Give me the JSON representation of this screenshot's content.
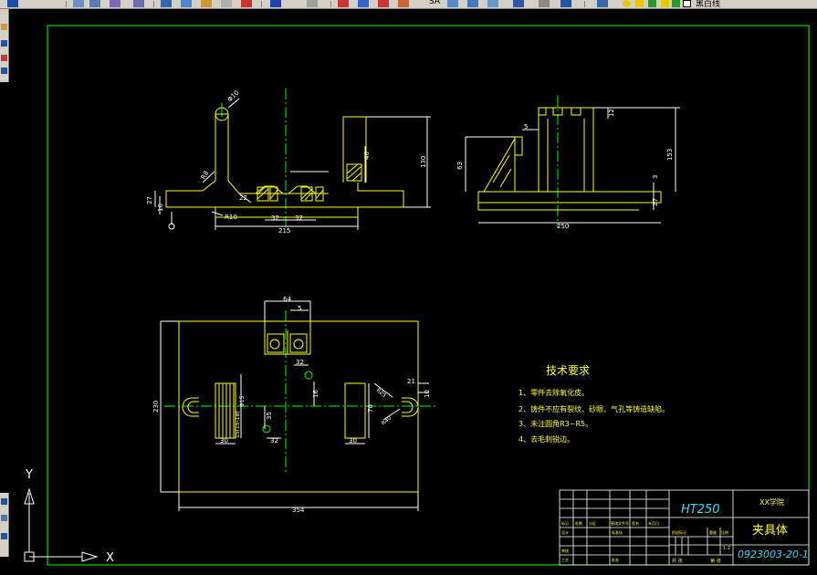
{
  "toolbar": {
    "layer_label": "黑白线",
    "colors": {
      "face": "#d4d0c8",
      "blue": "#1c4fa8",
      "red": "#cc2222",
      "yellow": "#e8c800",
      "green": "#2a9a2a",
      "cyan": "#00a0c0"
    }
  },
  "drawing": {
    "colors": {
      "outline": "#ffff00",
      "frame": "#00ff00",
      "dimension": "#ffffff",
      "centerline": "#00ff00",
      "hatch": "#ffff00",
      "titleblock_cyan": "#33ddff"
    },
    "front_view_dims": {
      "phi10": "Φ10",
      "r8": "R8",
      "r10": "R10",
      "d27": "27",
      "d10": "10",
      "d215": "215",
      "d32a": "32",
      "d32b": "32",
      "d130": "130",
      "d40": "40",
      "d22": "22"
    },
    "side_view_dims": {
      "d5": "5",
      "d12": "12",
      "d153": "153",
      "d63": "63",
      "d3": "3",
      "d27": "27",
      "d250": "250"
    },
    "plan_view_dims": {
      "d64": "64",
      "d5": "5",
      "d230": "230",
      "d32": "32",
      "d16": "16",
      "phi15a": "Φ15",
      "d18_15": "15(15-18)",
      "d30a": "30",
      "d35": "35",
      "d32b": "32",
      "d354": "354",
      "d70": "70",
      "d30b": "30",
      "r25": "R25",
      "r40": "R40",
      "d21": "21",
      "d10": "10"
    },
    "tech_req": {
      "title": "技术要求",
      "items": [
        "1、零件去除氧化皮。",
        "2、铸件不应有裂纹、砂眼、气孔等铸造缺陷。",
        "3、未注圆角R3~R5。",
        "4、去毛刺锐边。"
      ]
    },
    "title_block": {
      "material": "HT250",
      "school": "XX学院",
      "part_name": "夹具体",
      "drawing_no": "0923003-20-1",
      "scale": "1:2",
      "sheet_total": "共 张",
      "sheet_index": "第 张",
      "row_labels": [
        "标记",
        "处数",
        "分区",
        "更改文件号",
        "签名",
        "年月日"
      ],
      "design": "设计",
      "check": "审核",
      "std": "标准化",
      "process": "工艺",
      "approve": "批准",
      "stage": "阶段标记",
      "weight": "重量",
      "ratio": "比例"
    },
    "ucs": {
      "x_label": "X",
      "y_label": "Y"
    }
  }
}
